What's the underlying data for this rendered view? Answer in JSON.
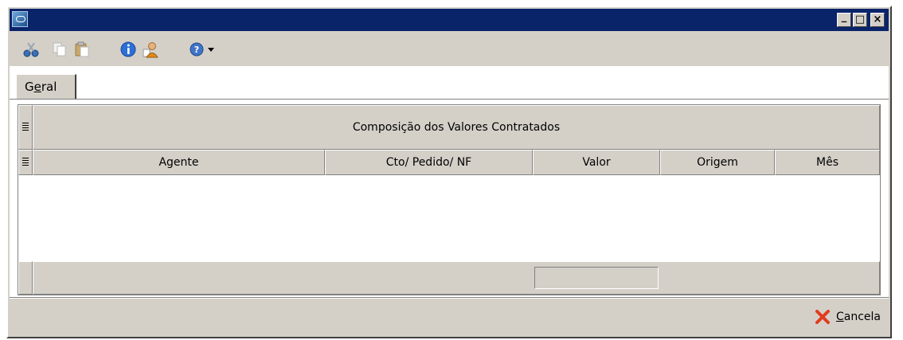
{
  "window": {
    "title": "",
    "controls": {
      "minimize_glyph": "_",
      "maximize_glyph": "□",
      "close_glyph": "×"
    }
  },
  "toolbar": {
    "icons": [
      "cut-icon",
      "copy-icon",
      "paste-icon",
      "info-icon",
      "user-icon",
      "help-icon",
      "dropdown-arrow-icon"
    ]
  },
  "tabs": [
    {
      "label_pre": "G",
      "label_u": "e",
      "label_post": "ral",
      "active": true
    }
  ],
  "grid": {
    "group_header": "Composição dos Valores Contratados",
    "columns": [
      "Agente",
      "Cto/ Pedido/ NF",
      "Valor",
      "Origem",
      "Mês"
    ],
    "rows": []
  },
  "footer": {
    "cancel_pre": "",
    "cancel_u": "C",
    "cancel_post": "ancela"
  },
  "colors": {
    "titlebar": "#0a246a",
    "face": "#d4d0c8",
    "cancel_x": "#e03c1f"
  }
}
